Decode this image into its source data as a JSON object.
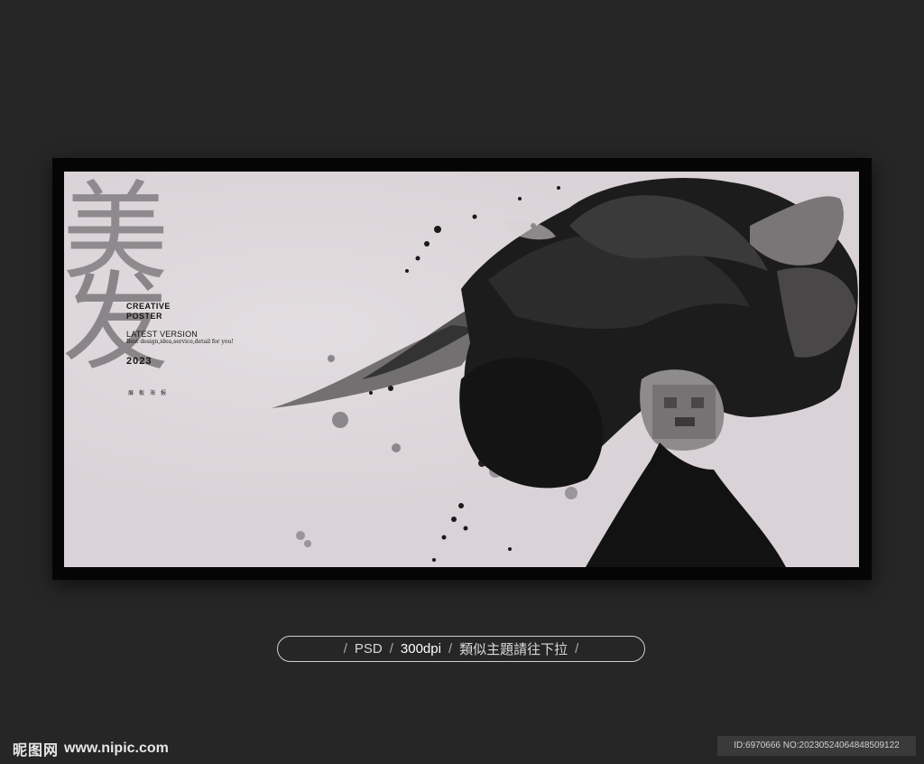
{
  "poster": {
    "char1": "美",
    "char2": "发",
    "creative_poster": "CREATIVE POSTER",
    "latest_version": "LATEST VERSION",
    "tagline": "Best design,idea,service,detail for you!",
    "year": "2023",
    "cn_tag": "展板海报"
  },
  "info_bar": {
    "sep": "/",
    "format": "PSD",
    "resolution": "300dpi",
    "hint": "類似主題請往下拉"
  },
  "watermark": {
    "site_cn": "昵图网",
    "site_url": "www.nipic.com",
    "id_text": "ID:6970666 NO:20230524064848509122"
  },
  "colors": {
    "background": "#262627",
    "poster_bg": "#d9d2d6",
    "ink": "#141414"
  }
}
